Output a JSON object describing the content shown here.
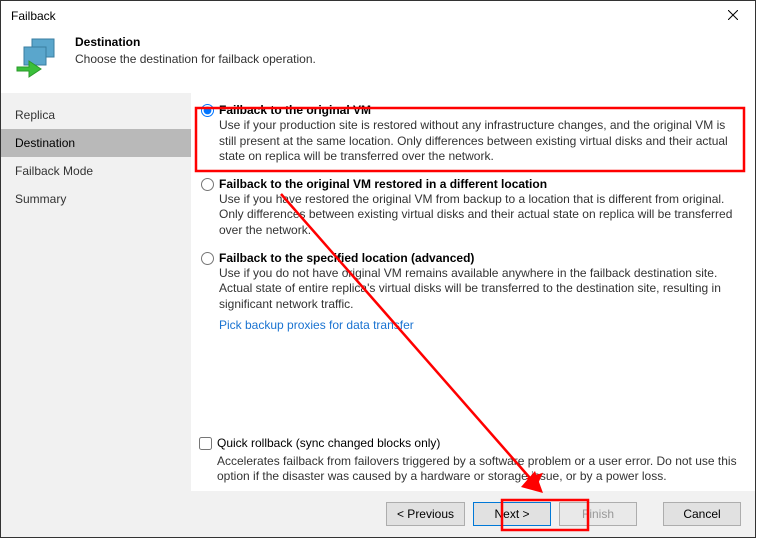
{
  "window_title": "Failback",
  "header": {
    "heading": "Destination",
    "sub": "Choose the destination for failback operation."
  },
  "sidebar": {
    "items": [
      {
        "label": "Replica"
      },
      {
        "label": "Destination"
      },
      {
        "label": "Failback Mode"
      },
      {
        "label": "Summary"
      }
    ],
    "active_index": 1
  },
  "options": [
    {
      "title": "Failback to the original VM",
      "desc": "Use if your production site is restored without any infrastructure changes, and the original VM is still present at the same location. Only differences between existing virtual disks and their actual state on replica will be transferred over the network."
    },
    {
      "title": "Failback to the original VM restored in a different location",
      "desc": "Use if you have restored the original VM from backup to a location that is different from original. Only differences between existing virtual disks and their actual state on replica will be transferred over the network."
    },
    {
      "title": "Failback to the specified location (advanced)",
      "desc": "Use if you do not have original VM remains available anywhere in the failback destination site. Actual state of entire replica's virtual disks will be transferred to the destination site, resulting in significant network traffic."
    }
  ],
  "selected_option": 0,
  "link_text": "Pick backup proxies for data transfer",
  "quick_rollback": {
    "label": "Quick rollback (sync changed blocks only)",
    "desc": "Accelerates failback from failovers triggered by a software problem or a user error. Do not use this option if the disaster was caused by a hardware or storage issue, or by a power loss.",
    "checked": false
  },
  "buttons": {
    "previous": "< Previous",
    "next": "Next >",
    "finish": "Finish",
    "cancel": "Cancel"
  }
}
